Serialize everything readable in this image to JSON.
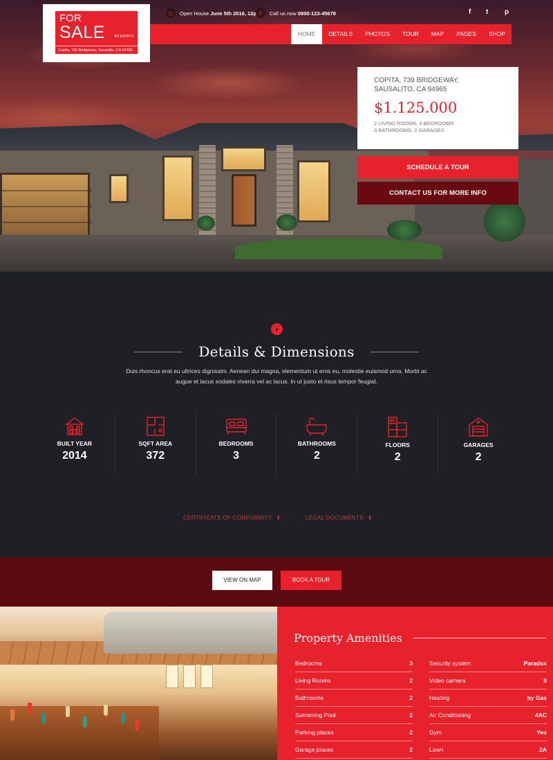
{
  "logo": {
    "line1": "FOR",
    "line2": "SALE",
    "by": "BY ESTATO",
    "address": "Copita, 739 Bridgeway, Sausalito, CA 94965"
  },
  "topbar": {
    "open_house_prefix": "Open House",
    "open_house_value": "June 5th 2016, 12pm",
    "call_prefix": "Call us now",
    "call_value": "0800-123-45678",
    "social": [
      "f",
      "t",
      "p"
    ]
  },
  "nav": [
    "HOME",
    "DETAILS",
    "PHOTOS",
    "TOUR",
    "MAP",
    "PAGES",
    "SHOP"
  ],
  "listing": {
    "address_line1": "COPITA, 739 BRIDGEWAY,",
    "address_line2": "SAUSALITO, CA 94965",
    "price": "$1.125.000",
    "spec_line1": "2 LIVING ROOMS, 4 BEDROOMS",
    "spec_line2": "3 BATHROOMS, 2 GARAGES",
    "schedule_button": "SCHEDULE A TOUR",
    "contact_button": "CONTACT US FOR MORE INFO"
  },
  "details": {
    "title": "Details & Dimensions",
    "description": "Duis rhoncus erat eu ultrices dignissim. Aenean dui magna, elementum ut eros eu, molestie euismod urna. Morbi ac augue et lacus sodales viverra vel ac lacus. In ut justo et risus tempor feugiat.",
    "stats": [
      {
        "label": "BUILT YEAR",
        "value": "2014",
        "icon": "house-icon"
      },
      {
        "label": "SQFT AREA",
        "value": "372",
        "icon": "floorplan-icon"
      },
      {
        "label": "BEDROOMS",
        "value": "3",
        "icon": "bed-icon"
      },
      {
        "label": "BATHROOMS",
        "value": "2",
        "icon": "bathtub-icon"
      },
      {
        "label": "FLOORS",
        "value": "2",
        "icon": "floors-icon"
      },
      {
        "label": "GARAGES",
        "value": "2",
        "icon": "garage-icon"
      }
    ],
    "certificate_link": "CERTIFICATE OF CONFORMITY",
    "legal_link": "LEGAL DOCUMENTS"
  },
  "cta": {
    "map_button": "VIEW ON MAP",
    "book_button": "BOOK A TOUR"
  },
  "amenities": {
    "title": "Property Amenities",
    "left": [
      {
        "name": "Bedrooms",
        "value": "3"
      },
      {
        "name": "Living Rooms",
        "value": "2"
      },
      {
        "name": "Bathrooms",
        "value": "2"
      },
      {
        "name": "Swimming Pool",
        "value": "2"
      },
      {
        "name": "Parking places",
        "value": "2"
      },
      {
        "name": "Garage places",
        "value": "2"
      }
    ],
    "right": [
      {
        "name": "Security system",
        "value": "Paradox"
      },
      {
        "name": "Video camera",
        "value": "8"
      },
      {
        "name": "Heating",
        "value": "by Gas"
      },
      {
        "name": "Air Conditioning",
        "value": "4AC"
      },
      {
        "name": "Gym",
        "value": "Yes"
      },
      {
        "name": "Lawn",
        "value": "2A"
      }
    ]
  },
  "colors": {
    "accent": "#e8222d",
    "dark": "#1f2026",
    "maroon": "#5c0a0f"
  }
}
